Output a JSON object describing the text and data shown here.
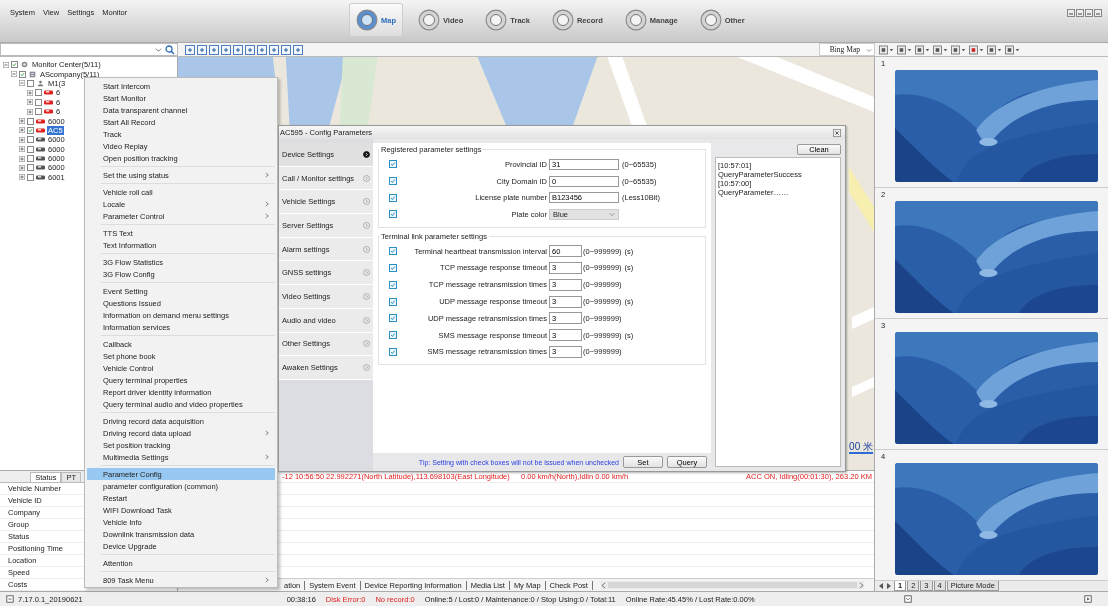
{
  "menu_bar": [
    "System",
    "View",
    "Settings",
    "Monitor"
  ],
  "module_tabs": [
    {
      "label": "Map",
      "selected": true
    },
    {
      "label": "Video",
      "selected": false
    },
    {
      "label": "Track",
      "selected": false
    },
    {
      "label": "Record",
      "selected": false
    },
    {
      "label": "Manage",
      "selected": false
    },
    {
      "label": "Other",
      "selected": false
    }
  ],
  "map_type": "Bing Map",
  "tree": [
    {
      "kind": "center",
      "label": "Monitor Center(5/11)",
      "checked": true,
      "expanded": true,
      "selected": false,
      "children": [
        {
          "kind": "company",
          "label": "AScompany(5/11)",
          "checked": true,
          "expanded": true,
          "selected": false,
          "children": [
            {
              "kind": "group",
              "label": "M1(3",
              "checked": false,
              "expanded": true,
              "selected": false,
              "children": [
                {
                  "kind": "vehicle",
                  "label": "6",
                  "checked": false,
                  "expanded": false,
                  "selected": false,
                  "online": true
                },
                {
                  "kind": "vehicle",
                  "label": "6",
                  "checked": false,
                  "expanded": false,
                  "selected": false,
                  "online": true
                },
                {
                  "kind": "vehicle",
                  "label": "6",
                  "checked": false,
                  "expanded": false,
                  "selected": false,
                  "online": true
                }
              ]
            },
            {
              "kind": "vehicle",
              "label": "6000",
              "checked": false,
              "expanded": false,
              "selected": false,
              "online": true
            },
            {
              "kind": "vehicle",
              "label": "AC5",
              "checked": true,
              "expanded": false,
              "selected": true,
              "online": true
            },
            {
              "kind": "vehicle",
              "label": "6000",
              "checked": false,
              "expanded": false,
              "selected": false,
              "online": false
            },
            {
              "kind": "vehicle",
              "label": "6000",
              "checked": false,
              "expanded": false,
              "selected": false,
              "online": false
            },
            {
              "kind": "vehicle",
              "label": "6000",
              "checked": false,
              "expanded": false,
              "selected": false,
              "online": false
            },
            {
              "kind": "vehicle",
              "label": "6000",
              "checked": false,
              "expanded": false,
              "selected": false,
              "online": false
            },
            {
              "kind": "vehicle",
              "label": "6001",
              "checked": false,
              "expanded": false,
              "selected": false,
              "online": false
            }
          ]
        }
      ]
    }
  ],
  "status_panel": {
    "tabs": [
      {
        "label": "Status",
        "selected": true
      },
      {
        "label": "PT",
        "selected": false
      }
    ],
    "fields": [
      "Vehicle Number",
      "Vehicle ID",
      "Company",
      "Group",
      "Status",
      "Positioning Time",
      "Location",
      "Speed",
      "Costs"
    ]
  },
  "context_menu": [
    [
      {
        "label": "Start Intercom",
        "submenu": false,
        "selected": false
      },
      {
        "label": "Start Monitor",
        "submenu": false,
        "selected": false
      },
      {
        "label": "Data transparent channel",
        "submenu": false,
        "selected": false
      },
      {
        "label": "Start All Record",
        "submenu": false,
        "selected": false
      },
      {
        "label": "Track",
        "submenu": false,
        "selected": false
      },
      {
        "label": "Video Replay",
        "submenu": false,
        "selected": false
      },
      {
        "label": "Open position tracking",
        "submenu": false,
        "selected": false
      }
    ],
    [
      {
        "label": "Set the using status",
        "submenu": true,
        "selected": false
      }
    ],
    [
      {
        "label": "Vehicle roll call",
        "submenu": false,
        "selected": false
      },
      {
        "label": "Locale",
        "submenu": true,
        "selected": false
      },
      {
        "label": "Parameter Control",
        "submenu": true,
        "selected": false
      }
    ],
    [
      {
        "label": "TTS Text",
        "submenu": false,
        "selected": false
      },
      {
        "label": "Text Information",
        "submenu": false,
        "selected": false
      }
    ],
    [
      {
        "label": "3G Flow Statistics",
        "submenu": false,
        "selected": false
      },
      {
        "label": "3G Flow Config",
        "submenu": false,
        "selected": false
      }
    ],
    [
      {
        "label": "Event Setting",
        "submenu": false,
        "selected": false
      },
      {
        "label": "Questions Issued",
        "submenu": false,
        "selected": false
      },
      {
        "label": "Information on demand menu settings",
        "submenu": false,
        "selected": false
      },
      {
        "label": "Information services",
        "submenu": false,
        "selected": false
      }
    ],
    [
      {
        "label": "Callback",
        "submenu": false,
        "selected": false
      },
      {
        "label": "Set phone book",
        "submenu": false,
        "selected": false
      },
      {
        "label": "Vehicle Control",
        "submenu": false,
        "selected": false
      },
      {
        "label": "Query terminal properties",
        "submenu": false,
        "selected": false
      },
      {
        "label": "Report driver identity information",
        "submenu": false,
        "selected": false
      },
      {
        "label": "Query terminal audio and video properties",
        "submenu": false,
        "selected": false
      }
    ],
    [
      {
        "label": "Driving record data acquisition",
        "submenu": false,
        "selected": false
      },
      {
        "label": "Driving record data upload",
        "submenu": true,
        "selected": false
      },
      {
        "label": "Set position tracking",
        "submenu": false,
        "selected": false
      },
      {
        "label": "Multimedia Settings",
        "submenu": true,
        "selected": false
      }
    ],
    [
      {
        "label": "Parameter Config",
        "submenu": false,
        "selected": true
      },
      {
        "label": "parameter configuration (common)",
        "submenu": false,
        "selected": false
      },
      {
        "label": "Restart",
        "submenu": false,
        "selected": false
      },
      {
        "label": "WIFI Download Task",
        "submenu": false,
        "selected": false
      },
      {
        "label": "Vehicle Info",
        "submenu": false,
        "selected": false
      },
      {
        "label": "Downlink transmission data",
        "submenu": false,
        "selected": false
      },
      {
        "label": "Device Upgrade",
        "submenu": false,
        "selected": false
      }
    ],
    [
      {
        "label": "Attention",
        "submenu": false,
        "selected": false
      }
    ],
    [
      {
        "label": "809 Task Menu",
        "submenu": true,
        "selected": false
      }
    ]
  ],
  "dialog": {
    "title": "AC595 - Config Parameters",
    "nav": [
      {
        "label": "Device Settings",
        "selected": true
      },
      {
        "label": "Call / Monitor settings",
        "selected": false
      },
      {
        "label": "Vehicle Settings",
        "selected": false
      },
      {
        "label": "Server Settings",
        "selected": false
      },
      {
        "label": "Alarm settings",
        "selected": false
      },
      {
        "label": "GNSS settings",
        "selected": false
      },
      {
        "label": "Video Settings",
        "selected": false
      },
      {
        "label": "Audio and video",
        "selected": false
      },
      {
        "label": "Other Settings",
        "selected": false
      },
      {
        "label": "Awaken Settings",
        "selected": false
      }
    ],
    "registered": {
      "title": "Registered parameter settings",
      "rows": [
        {
          "kind": "input",
          "checked": true,
          "label": "Provincial ID",
          "value": "31",
          "range": "(0~65535)"
        },
        {
          "kind": "input",
          "checked": true,
          "label": "City Domain ID",
          "value": "0",
          "range": "(0~65535)"
        },
        {
          "kind": "input",
          "checked": true,
          "label": "License plate number",
          "value": "B123456",
          "range": "(Less10Bit)"
        },
        {
          "kind": "select",
          "checked": true,
          "label": "Plate color",
          "value": "Blue"
        }
      ]
    },
    "terminal": {
      "title": "Terminal link parameter settings",
      "rows": [
        {
          "checked": true,
          "label": "Terminal heartbeat transmission interval",
          "value": "60",
          "range": "(0~999999)",
          "unit": "(s)"
        },
        {
          "checked": true,
          "label": "TCP message response timeout",
          "value": "3",
          "range": "(0~999999)",
          "unit": "(s)"
        },
        {
          "checked": true,
          "label": "TCP message retransmission times",
          "value": "3",
          "range": "(0~999999)"
        },
        {
          "checked": true,
          "label": "UDP message response timeout",
          "value": "3",
          "range": "(0~999999)",
          "unit": "(s)"
        },
        {
          "checked": true,
          "label": "UDP message retransmission times",
          "value": "3",
          "range": "(0~999999)"
        },
        {
          "checked": true,
          "label": "SMS message response timeout",
          "value": "3",
          "range": "(0~999999)",
          "unit": "(s)"
        },
        {
          "checked": true,
          "label": "SMS message retransmission times",
          "value": "3",
          "range": "(0~999999)"
        }
      ]
    },
    "tip": "Tip: Setting with check boxes will not be issued when unchecked",
    "buttons": [
      "Set",
      "Query"
    ],
    "clean_button": "Clean",
    "log": [
      "[10:57:01]",
      "QueryParameterSuccess",
      "[10:57:00]",
      "QueryParameter……"
    ]
  },
  "map_scale": "00 米",
  "data_row": [
    "-12 10:56:50",
    "22.992271(North Latitude),113.698103(East Longitude)",
    "0.00 km/h(North),Idlin 0.00 km/h",
    "ACC ON, Idling(00:01:30), 263.20 KM"
  ],
  "bottom_tabs": [
    "ation",
    "System Event",
    "Device Reporting Information",
    "Media List",
    "My Map",
    "Check Post"
  ],
  "video_slots": [
    "1",
    "2",
    "3",
    "4"
  ],
  "video_tabs": [
    {
      "label": "1",
      "selected": true
    },
    {
      "label": "2",
      "selected": false
    },
    {
      "label": "3",
      "selected": false
    },
    {
      "label": "4",
      "selected": false
    },
    {
      "label": "Picture Mode",
      "selected": false
    }
  ],
  "status_bar": {
    "version": "7.17.0.1_20190621",
    "time": "00:38:16",
    "disk_error": "Disk Error:0",
    "no_record": "No record:0",
    "counts": "Online:5 / Lost:0 / Maintenance:0 / Stop Using:0 / Total:11",
    "rates": "Online Rate:45.45% / Lost Rate:0.00%"
  }
}
